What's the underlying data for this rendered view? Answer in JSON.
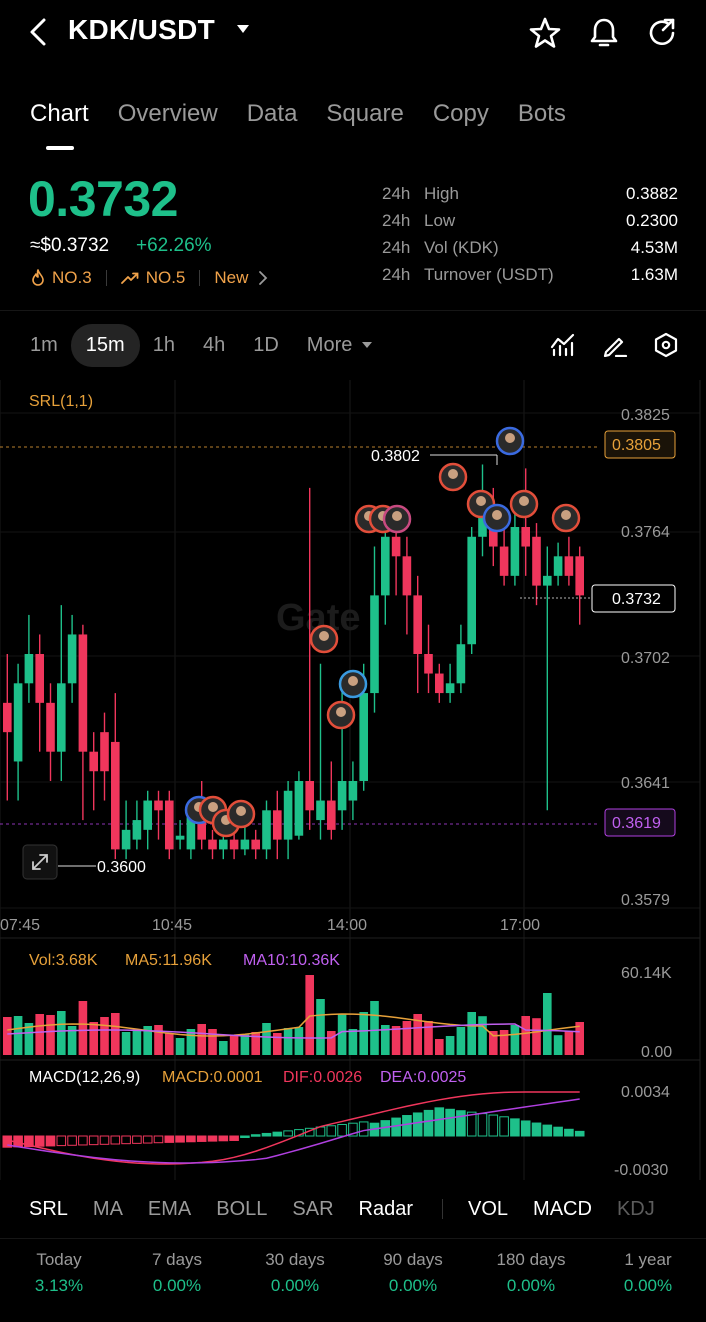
{
  "header": {
    "pair": "KDK/USDT",
    "icons": [
      "back-arrow-icon",
      "caret-down-icon",
      "star-icon",
      "bell-icon",
      "share-refresh-icon"
    ]
  },
  "tabs": [
    {
      "label": "Chart",
      "active": true
    },
    {
      "label": "Overview",
      "active": false
    },
    {
      "label": "Data",
      "active": false
    },
    {
      "label": "Square",
      "active": false
    },
    {
      "label": "Copy",
      "active": false
    },
    {
      "label": "Bots",
      "active": false
    }
  ],
  "price": {
    "last": "0.3732",
    "usd": "≈$0.3732",
    "change": "+62.26%",
    "badge1": "NO.3",
    "badge2": "NO.5",
    "badge3": "New"
  },
  "stats": [
    {
      "prefix": "24h",
      "label": "High",
      "value": "0.3882"
    },
    {
      "prefix": "24h",
      "label": "Low",
      "value": "0.2300"
    },
    {
      "prefix": "24h",
      "label": "Vol (KDK)",
      "value": "4.53M"
    },
    {
      "prefix": "24h",
      "label": "Turnover (USDT)",
      "value": "1.63M"
    }
  ],
  "timeframes": [
    {
      "label": "1m",
      "active": false
    },
    {
      "label": "15m",
      "active": true
    },
    {
      "label": "1h",
      "active": false
    },
    {
      "label": "4h",
      "active": false
    },
    {
      "label": "1D",
      "active": false
    }
  ],
  "more_label": "More",
  "indicators": [
    {
      "label": "SRL",
      "on": true
    },
    {
      "label": "MA",
      "on": false
    },
    {
      "label": "EMA",
      "on": false
    },
    {
      "label": "BOLL",
      "on": false
    },
    {
      "label": "SAR",
      "on": false
    },
    {
      "label": "Radar",
      "on": true
    },
    {
      "label": "VOL",
      "on": true,
      "group": 2
    },
    {
      "label": "MACD",
      "on": true,
      "group": 2
    },
    {
      "label": "KDJ",
      "on": false,
      "group": 2
    }
  ],
  "performance": [
    {
      "label": "Today",
      "value": "3.13%"
    },
    {
      "label": "7 days",
      "value": "0.00%"
    },
    {
      "label": "30 days",
      "value": "0.00%"
    },
    {
      "label": "90 days",
      "value": "0.00%"
    },
    {
      "label": "180 days",
      "value": "0.00%"
    },
    {
      "label": "1 year",
      "value": "0.00%"
    }
  ],
  "colors": {
    "up": "#1ec08a",
    "down": "#f0365c",
    "accent_orange": "#e7a13a",
    "purple": "#b040e0"
  },
  "chart_data": {
    "type": "candlestick",
    "indicator_label": "SRL(1,1)",
    "y_ticks": [
      "0.3825",
      "0.3764",
      "0.3702",
      "0.3641",
      "0.3579"
    ],
    "x_ticks": [
      "07:45",
      "10:45",
      "14:00",
      "17:00"
    ],
    "marker_high": "0.3802",
    "marker_low": "0.3600",
    "resistance_label": "0.3805",
    "current_label": "0.3732",
    "support_label": "0.3619",
    "watermark": "Gate",
    "ylim": [
      0.3575,
      0.3835
    ],
    "candles": [
      {
        "o": 0.368,
        "c": 0.3665,
        "h": 0.3705,
        "l": 0.363
      },
      {
        "o": 0.365,
        "c": 0.369,
        "h": 0.37,
        "l": 0.363
      },
      {
        "o": 0.369,
        "c": 0.3705,
        "h": 0.3725,
        "l": 0.368
      },
      {
        "o": 0.3705,
        "c": 0.368,
        "h": 0.3715,
        "l": 0.3655
      },
      {
        "o": 0.368,
        "c": 0.3655,
        "h": 0.369,
        "l": 0.364
      },
      {
        "o": 0.3655,
        "c": 0.369,
        "h": 0.373,
        "l": 0.364
      },
      {
        "o": 0.369,
        "c": 0.3715,
        "h": 0.3725,
        "l": 0.368
      },
      {
        "o": 0.3715,
        "c": 0.3655,
        "h": 0.372,
        "l": 0.362
      },
      {
        "o": 0.3655,
        "c": 0.3645,
        "h": 0.3665,
        "l": 0.3625
      },
      {
        "o": 0.3665,
        "c": 0.3645,
        "h": 0.3675,
        "l": 0.363
      },
      {
        "o": 0.366,
        "c": 0.3605,
        "h": 0.3685,
        "l": 0.36
      },
      {
        "o": 0.3605,
        "c": 0.3615,
        "h": 0.363,
        "l": 0.36
      },
      {
        "o": 0.361,
        "c": 0.362,
        "h": 0.363,
        "l": 0.3605
      },
      {
        "o": 0.3615,
        "c": 0.363,
        "h": 0.3635,
        "l": 0.3605
      },
      {
        "o": 0.363,
        "c": 0.3625,
        "h": 0.3635,
        "l": 0.361
      },
      {
        "o": 0.363,
        "c": 0.3605,
        "h": 0.3635,
        "l": 0.36
      },
      {
        "o": 0.361,
        "c": 0.3612,
        "h": 0.362,
        "l": 0.3605
      },
      {
        "o": 0.3605,
        "c": 0.3625,
        "h": 0.363,
        "l": 0.36
      },
      {
        "o": 0.3625,
        "c": 0.361,
        "h": 0.364,
        "l": 0.3605
      },
      {
        "o": 0.361,
        "c": 0.3605,
        "h": 0.3615,
        "l": 0.36
      },
      {
        "o": 0.3605,
        "c": 0.361,
        "h": 0.3615,
        "l": 0.36
      },
      {
        "o": 0.361,
        "c": 0.3605,
        "h": 0.362,
        "l": 0.36
      },
      {
        "o": 0.3605,
        "c": 0.361,
        "h": 0.3618,
        "l": 0.3602
      },
      {
        "o": 0.361,
        "c": 0.3605,
        "h": 0.3615,
        "l": 0.36
      },
      {
        "o": 0.3605,
        "c": 0.3625,
        "h": 0.363,
        "l": 0.36
      },
      {
        "o": 0.3625,
        "c": 0.361,
        "h": 0.3635,
        "l": 0.36
      },
      {
        "o": 0.361,
        "c": 0.3635,
        "h": 0.364,
        "l": 0.36
      },
      {
        "o": 0.3612,
        "c": 0.364,
        "h": 0.3645,
        "l": 0.361
      },
      {
        "o": 0.364,
        "c": 0.3625,
        "h": 0.379,
        "l": 0.3615
      },
      {
        "o": 0.362,
        "c": 0.363,
        "h": 0.37,
        "l": 0.361
      },
      {
        "o": 0.363,
        "c": 0.3615,
        "h": 0.365,
        "l": 0.361
      },
      {
        "o": 0.3625,
        "c": 0.364,
        "h": 0.369,
        "l": 0.3615
      },
      {
        "o": 0.363,
        "c": 0.364,
        "h": 0.365,
        "l": 0.362
      },
      {
        "o": 0.364,
        "c": 0.3685,
        "h": 0.37,
        "l": 0.3635
      },
      {
        "o": 0.3685,
        "c": 0.3735,
        "h": 0.376,
        "l": 0.3675
      },
      {
        "o": 0.3735,
        "c": 0.3765,
        "h": 0.3775,
        "l": 0.372
      },
      {
        "o": 0.3765,
        "c": 0.3755,
        "h": 0.378,
        "l": 0.3735
      },
      {
        "o": 0.3755,
        "c": 0.3735,
        "h": 0.3765,
        "l": 0.3715
      },
      {
        "o": 0.3735,
        "c": 0.3705,
        "h": 0.3745,
        "l": 0.3685
      },
      {
        "o": 0.3705,
        "c": 0.3695,
        "h": 0.372,
        "l": 0.3685
      },
      {
        "o": 0.3695,
        "c": 0.3685,
        "h": 0.37,
        "l": 0.368
      },
      {
        "o": 0.3685,
        "c": 0.369,
        "h": 0.37,
        "l": 0.368
      },
      {
        "o": 0.369,
        "c": 0.371,
        "h": 0.372,
        "l": 0.3685
      },
      {
        "o": 0.371,
        "c": 0.3765,
        "h": 0.377,
        "l": 0.3705
      },
      {
        "o": 0.3765,
        "c": 0.378,
        "h": 0.3802,
        "l": 0.3755
      },
      {
        "o": 0.3775,
        "c": 0.376,
        "h": 0.379,
        "l": 0.375
      },
      {
        "o": 0.376,
        "c": 0.3745,
        "h": 0.3775,
        "l": 0.374
      },
      {
        "o": 0.3745,
        "c": 0.377,
        "h": 0.378,
        "l": 0.374
      },
      {
        "o": 0.377,
        "c": 0.376,
        "h": 0.38,
        "l": 0.3745
      },
      {
        "o": 0.3765,
        "c": 0.374,
        "h": 0.3772,
        "l": 0.373
      },
      {
        "o": 0.374,
        "c": 0.3745,
        "h": 0.376,
        "l": 0.3625
      },
      {
        "o": 0.3745,
        "c": 0.3755,
        "h": 0.3762,
        "l": 0.374
      },
      {
        "o": 0.3755,
        "c": 0.3745,
        "h": 0.3765,
        "l": 0.374
      },
      {
        "o": 0.3755,
        "c": 0.3735,
        "h": 0.376,
        "l": 0.372
      }
    ],
    "volume": {
      "label": "Vol:3.68K",
      "ma5_label": "MA5:11.96K",
      "ma10_label": "MA10:10.36K",
      "y_max_label": "60.14K",
      "y_min_label": "0.00",
      "ymax": 60.14
    },
    "macd": {
      "label": "MACD(12,26,9)",
      "macd_label": "MACD:0.0001",
      "dif_label": "DIF:0.0026",
      "dea_label": "DEA:0.0025",
      "y_top_label": "0.0034",
      "y_bot_label": "-0.0030"
    }
  }
}
